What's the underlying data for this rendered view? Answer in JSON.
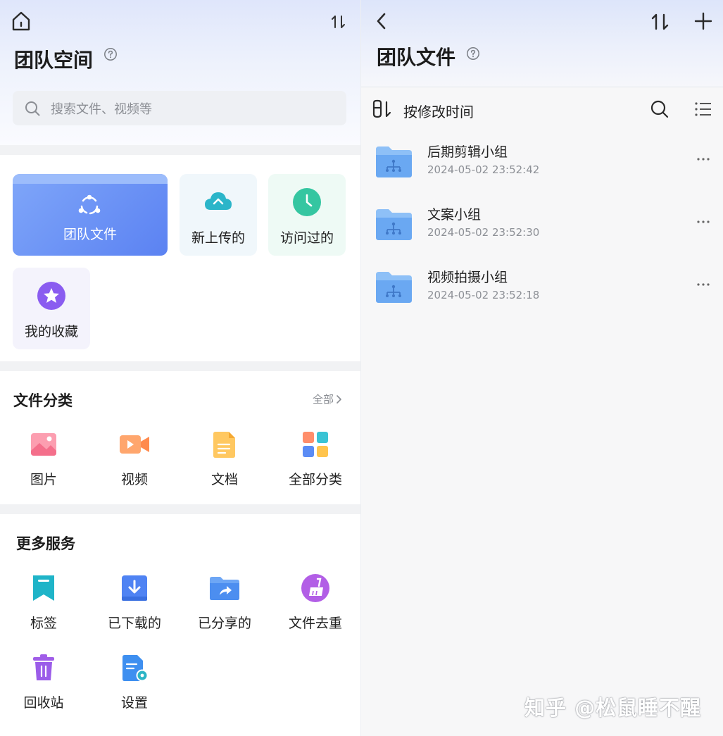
{
  "left": {
    "title": "团队空间",
    "search": {
      "placeholder": "搜索文件、视频等"
    },
    "quick": {
      "team_files": "团队文件",
      "new_uploads": "新上传的",
      "visited": "访问过的",
      "favorites": "我的收藏"
    },
    "categories": {
      "title": "文件分类",
      "all_link": "全部",
      "items": [
        {
          "label": "图片",
          "icon": "image-icon"
        },
        {
          "label": "视频",
          "icon": "video-icon"
        },
        {
          "label": "文档",
          "icon": "document-icon"
        },
        {
          "label": "全部分类",
          "icon": "all-categories-icon"
        }
      ]
    },
    "services": {
      "title": "更多服务",
      "items": [
        {
          "label": "标签",
          "icon": "bookmark-icon"
        },
        {
          "label": "已下载的",
          "icon": "download-icon"
        },
        {
          "label": "已分享的",
          "icon": "share-folder-icon"
        },
        {
          "label": "文件去重",
          "icon": "dedupe-broom-icon"
        },
        {
          "label": "回收站",
          "icon": "trash-icon"
        },
        {
          "label": "设置",
          "icon": "settings-icon"
        }
      ]
    }
  },
  "right": {
    "title": "团队文件",
    "sort_label": "按修改时间",
    "folders": [
      {
        "name": "后期剪辑小组",
        "modified": "2024-05-02 23:52:42"
      },
      {
        "name": "文案小组",
        "modified": "2024-05-02 23:52:30"
      },
      {
        "name": "视频拍摄小组",
        "modified": "2024-05-02 23:52:18"
      }
    ]
  },
  "watermark": "知乎 @松鼠睡不醒",
  "colors": {
    "accent_blue": "#5b82f2",
    "folder_blue": "#6aa8f2",
    "teal": "#2cb5c6",
    "green": "#35c6a1",
    "purple": "#8a5cf0",
    "text_secondary": "#8d9096"
  }
}
